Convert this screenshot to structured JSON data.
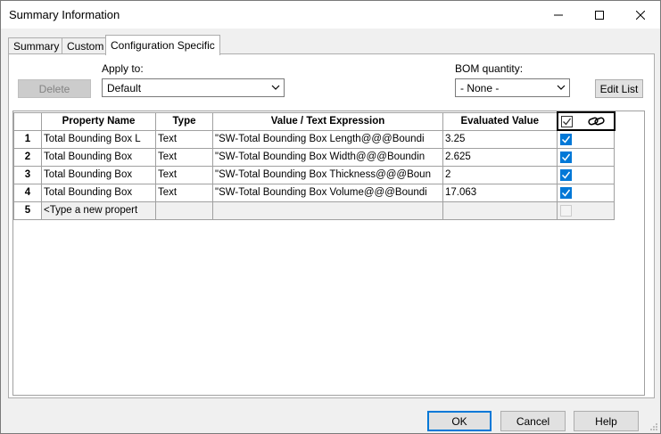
{
  "window": {
    "title": "Summary Information"
  },
  "tabs": [
    {
      "label": "Summary"
    },
    {
      "label": "Custom"
    },
    {
      "label": "Configuration Specific"
    }
  ],
  "controls": {
    "delete_label": "Delete",
    "apply_to_label": "Apply to:",
    "apply_to_value": "Default",
    "bom_label": "BOM quantity:",
    "bom_value": "- None -",
    "edit_list_label": "Edit List"
  },
  "table": {
    "headers": {
      "property_name": "Property Name",
      "type": "Type",
      "value": "Value / Text Expression",
      "evaluated": "Evaluated Value"
    },
    "rows": [
      {
        "num": "1",
        "name": "Total Bounding Box L",
        "type": "Text",
        "value": "\"SW-Total Bounding Box Length@@@Boundi",
        "evaluated": "3.25",
        "checked": true
      },
      {
        "num": "2",
        "name": "Total Bounding Box",
        "type": "Text",
        "value": "\"SW-Total Bounding Box Width@@@Boundin",
        "evaluated": "2.625",
        "checked": true
      },
      {
        "num": "3",
        "name": "Total Bounding Box",
        "type": "Text",
        "value": "\"SW-Total Bounding Box Thickness@@@Boun",
        "evaluated": "2",
        "checked": true
      },
      {
        "num": "4",
        "name": "Total Bounding Box",
        "type": "Text",
        "value": "\"SW-Total Bounding Box Volume@@@Boundi",
        "evaluated": "17.063",
        "checked": true
      }
    ],
    "new_row": {
      "num": "5",
      "placeholder": "<Type a new propert"
    }
  },
  "footer": {
    "ok_label": "OK",
    "cancel_label": "Cancel",
    "help_label": "Help"
  },
  "colors": {
    "accent": "#0078d7",
    "check": "#0078d7"
  }
}
